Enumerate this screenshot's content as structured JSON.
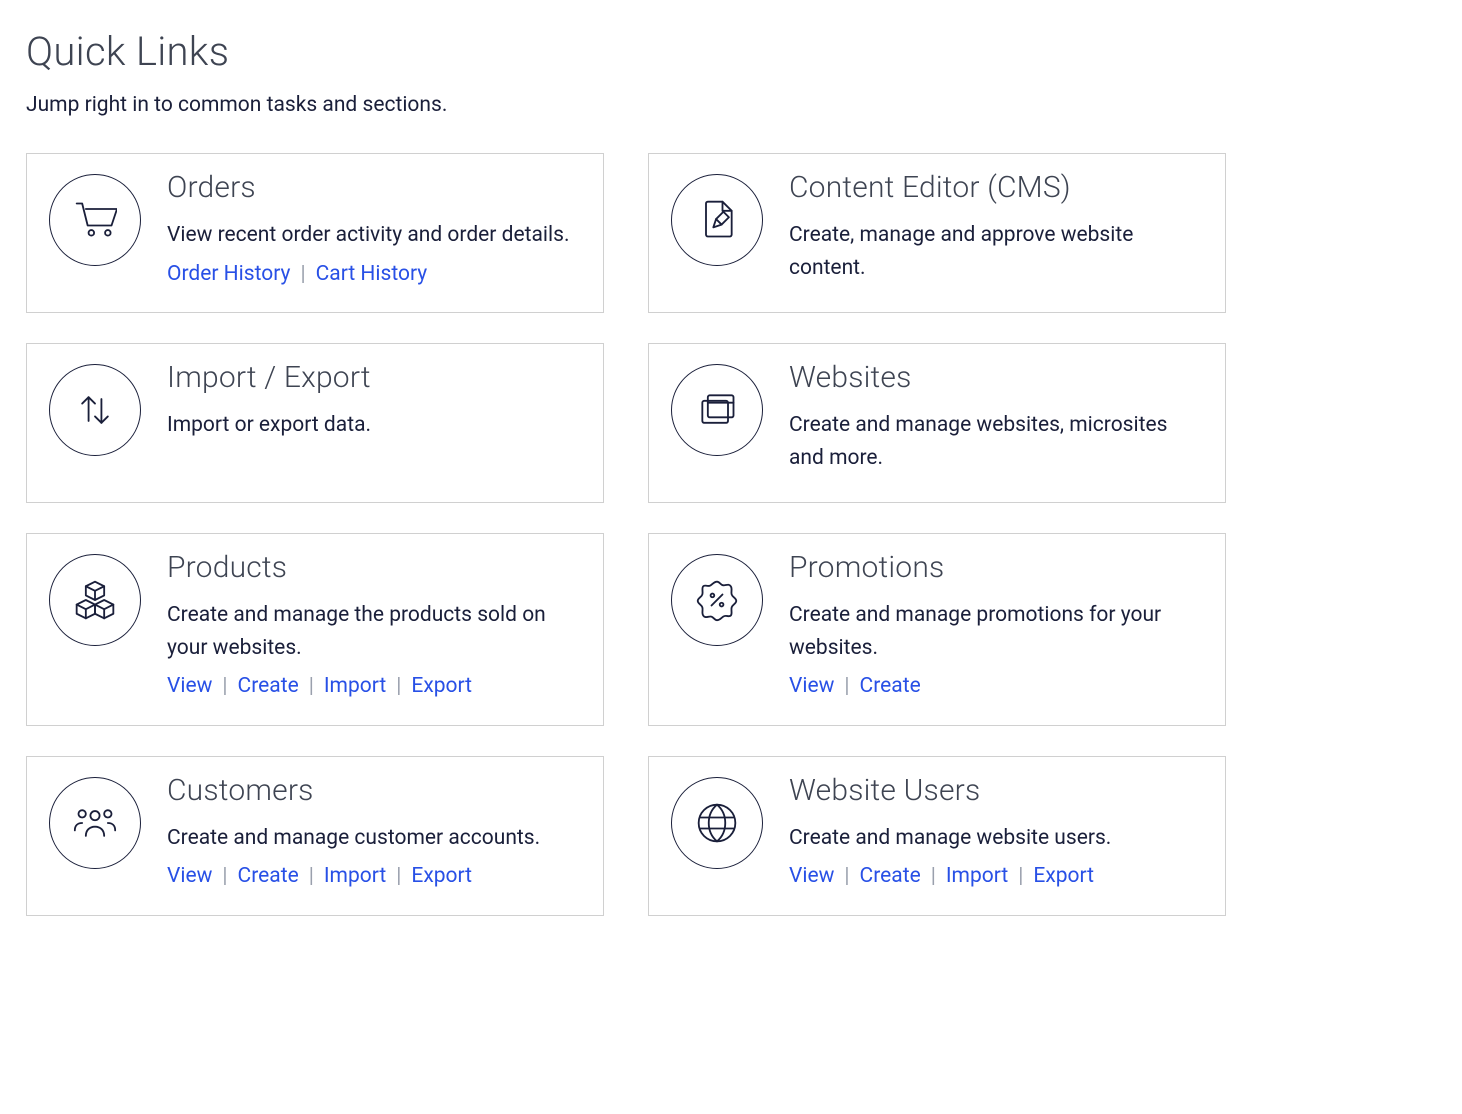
{
  "header": {
    "title": "Quick Links",
    "subtitle": "Jump right in to common tasks and sections."
  },
  "cards": [
    {
      "icon": "cart-icon",
      "title": "Orders",
      "description": "View recent order activity and order details.",
      "links": [
        "Order History",
        "Cart History"
      ]
    },
    {
      "icon": "document-edit-icon",
      "title": "Content Editor (CMS)",
      "description": "Create, manage and approve website content.",
      "links": []
    },
    {
      "icon": "import-export-icon",
      "title": "Import / Export",
      "description": "Import or export data.",
      "links": []
    },
    {
      "icon": "windows-icon",
      "title": "Websites",
      "description": "Create and manage websites, microsites and more.",
      "links": []
    },
    {
      "icon": "boxes-icon",
      "title": "Products",
      "description": "Create and manage the products sold on your websites.",
      "links": [
        "View",
        "Create",
        "Import",
        "Export"
      ]
    },
    {
      "icon": "promo-badge-icon",
      "title": "Promotions",
      "description": "Create and manage promotions for your websites.",
      "links": [
        "View",
        "Create"
      ]
    },
    {
      "icon": "people-icon",
      "title": "Customers",
      "description": "Create and manage customer accounts.",
      "links": [
        "View",
        "Create",
        "Import",
        "Export"
      ]
    },
    {
      "icon": "globe-icon",
      "title": "Website Users",
      "description": "Create and manage website users.",
      "links": [
        "View",
        "Create",
        "Import",
        "Export"
      ]
    }
  ]
}
